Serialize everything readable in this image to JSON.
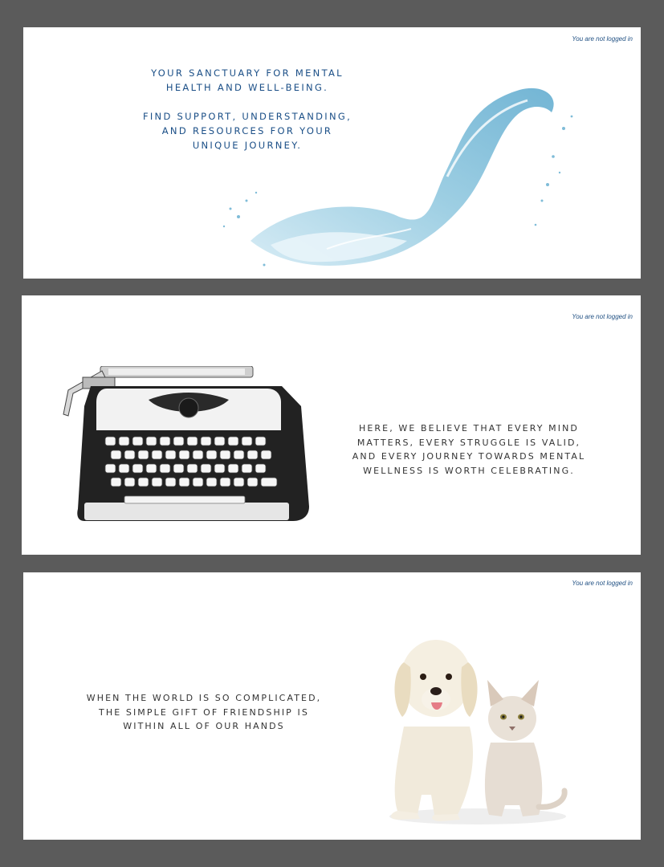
{
  "login_status": "You are not logged in",
  "panels": [
    {
      "lines": [
        "YOUR SANCTUARY FOR MENTAL",
        "HEALTH AND WELL-BEING.",
        "FIND SUPPORT, UNDERSTANDING,",
        "AND RESOURCES FOR YOUR",
        "UNIQUE JOURNEY."
      ],
      "image": "water-splash"
    },
    {
      "lines": [
        "HERE, WE BELIEVE THAT EVERY MIND",
        "MATTERS, EVERY STRUGGLE IS VALID,",
        "AND EVERY JOURNEY TOWARDS MENTAL",
        "WELLNESS IS WORTH CELEBRATING."
      ],
      "image": "typewriter"
    },
    {
      "lines": [
        "WHEN THE WORLD IS SO COMPLICATED,",
        "THE SIMPLE GIFT OF FRIENDSHIP IS",
        "WITHIN ALL OF OUR HANDS"
      ],
      "image": "puppy-and-kitten"
    }
  ],
  "colors": {
    "page_background": "#5b5b5b",
    "panel_background": "#ffffff",
    "accent_blue": "#1b4f87",
    "body_text": "#333333"
  }
}
